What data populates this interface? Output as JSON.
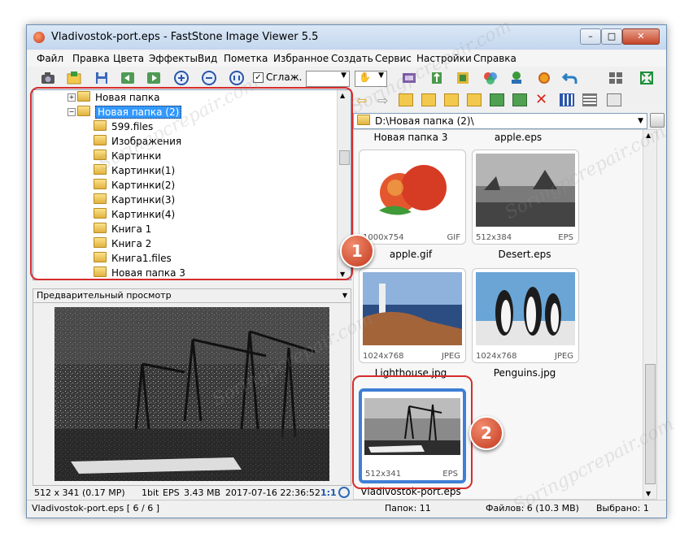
{
  "window": {
    "title": "Vladivostok-port.eps  -  FastStone Image Viewer 5.5",
    "minimize": "–",
    "maximize": "□",
    "close": "✕"
  },
  "menu": [
    "Файл",
    "Правка",
    "Цвета",
    "Эффекты",
    "Вид",
    "Пометка",
    "Избранное",
    "Создать",
    "Сервис",
    "Настройки",
    "Справка"
  ],
  "toolbar": {
    "smooth_label": "Сглаж."
  },
  "tree": {
    "items": [
      {
        "label": "Новая папка",
        "selected": false,
        "expanded": false
      },
      {
        "label": "Новая папка (2)",
        "selected": true,
        "expanded": true
      },
      {
        "label": "599.files"
      },
      {
        "label": "Изображения"
      },
      {
        "label": "Картинки"
      },
      {
        "label": "Картинки(1)"
      },
      {
        "label": "Картинки(2)"
      },
      {
        "label": "Картинки(3)"
      },
      {
        "label": "Картинки(4)"
      },
      {
        "label": "Книга 1"
      },
      {
        "label": "Книга 2"
      },
      {
        "label": "Книга1.files"
      },
      {
        "label": "Новая папка 3"
      }
    ]
  },
  "preview": {
    "header": "Предварительный просмотр"
  },
  "info": {
    "dims": "512 x 341 (0.17 MP)",
    "bits": "1bit",
    "fmt": "EPS",
    "size": "3.43 MB",
    "date": "2017-07-16 22:36:52",
    "zoom": "1:1"
  },
  "path": {
    "value": "D:\\Новая папка (2)\\"
  },
  "thumbs": {
    "top_labels": [
      "Новая папка 3",
      "apple.eps"
    ],
    "items": [
      {
        "name": "apple.gif",
        "dims": "1000x754",
        "fmt": "GIF"
      },
      {
        "name": "Desert.eps",
        "dims": "512x384",
        "fmt": "EPS"
      },
      {
        "name": "Lighthouse.jpg",
        "dims": "1024x768",
        "fmt": "JPEG"
      },
      {
        "name": "Penguins.jpg",
        "dims": "1024x768",
        "fmt": "JPEG"
      },
      {
        "name": "Vladivostok-port.eps",
        "dims": "512x341",
        "fmt": "EPS"
      }
    ]
  },
  "status": {
    "file": "Vladivostok-port.eps [ 6 / 6 ]",
    "folders": "Папок: 11",
    "files": "Файлов: 6 (10.3 MB)",
    "selected": "Выбрано: 1"
  },
  "callouts": [
    "1",
    "2"
  ],
  "watermark": "Soringpcrepair.com",
  "colors": {
    "callout": "#d62d2d",
    "selection": "#3399ff",
    "active_thumb": "#3f7fd6"
  }
}
